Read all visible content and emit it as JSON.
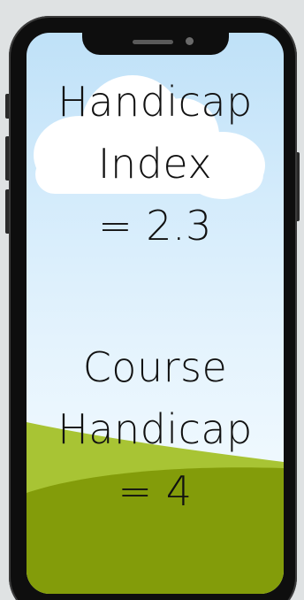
{
  "labels": {
    "handicap_index": {
      "line1": "Handicap",
      "line2": "Index",
      "line3": "= 2.3"
    },
    "course_handicap": {
      "line1": "Course",
      "line2": "Handicap",
      "line3": "= 4"
    }
  },
  "colors": {
    "sky_top": "#bfe1f8",
    "sky_bottom": "#f2f9fe",
    "cloud": "#ffffff",
    "hill_back": "#a8c434",
    "hill_front": "#839c0a",
    "phone_body": "#0e0e0e",
    "background": "#dfe2e3",
    "text": "#111111"
  }
}
